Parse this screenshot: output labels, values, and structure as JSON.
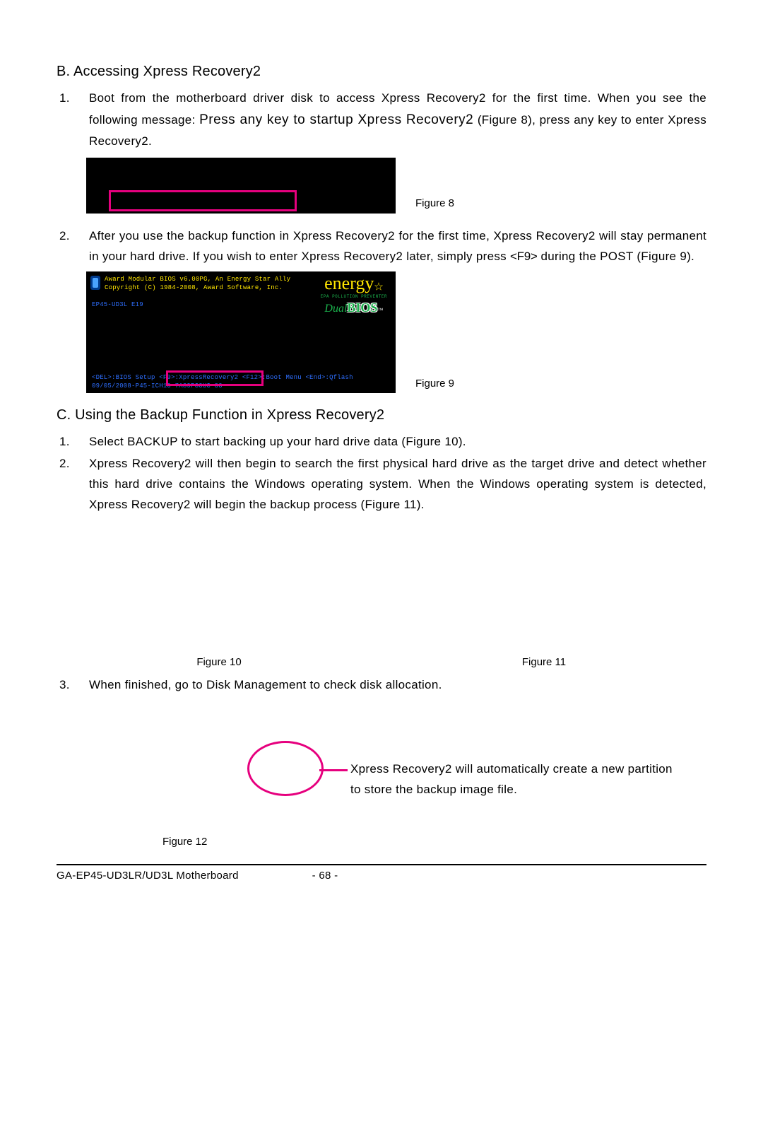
{
  "section_b": {
    "heading": "B. Accessing Xpress Recovery2",
    "item1": {
      "num": "1.",
      "text_a": "Boot from the motherboard driver disk to access Xpress Recovery2 for the first time. When you see the following message: ",
      "emph": "Press any key to startup Xpress Recovery2",
      "text_b": " (Figure 8), press any key to enter Xpress Recovery2."
    },
    "fig8_caption": "Figure 8",
    "item2": {
      "num": "2.",
      "text_a": "After you use the backup function in Xpress Recovery2 for the first time, Xpress Recovery2 will stay permanent in your hard drive. If you wish to enter Xpress Recovery2 later, simply press ",
      "key": "<F9>",
      "text_b": " during the POST (Figure 9)."
    },
    "fig9": {
      "line1": "Award Modular BIOS v6.00PG, An Energy Star Ally",
      "line2": "Copyright (C) 1984-2008, Award Software, Inc.",
      "line3": "EP45-UD3L E19",
      "line4a": "<DEL>:BIOS Setup  <F",
      "line4b": "9>:XpressRecovery2  <F12",
      "line4c": ">:Boot Menu  <End>:Qflash",
      "line5": "09/05/2008-P45-ICH10-7A89PG0UC-00",
      "energy_label": "energy",
      "epa": "EPA  POLLUTION  PREVENTER",
      "dual": "Dual",
      "bios": "BIOS"
    },
    "fig9_caption": "Figure 9"
  },
  "section_c": {
    "heading": "C. Using the Backup Function in Xpress Recovery2",
    "item1": {
      "num": "1.",
      "text_a": "Select ",
      "backup": "BACKUP",
      "text_b": " to start backing up your hard drive data (Figure 10)."
    },
    "item2": {
      "num": "2.",
      "text": "Xpress Recovery2 will then begin to search the first physical hard drive as the target drive and detect whether this hard drive contains the Windows operating system. When the Windows operating system is detected, Xpress Recovery2 will begin the backup process (Figure 11)."
    },
    "fig10_caption": "Figure 10",
    "fig11_caption": "Figure 11",
    "item3": {
      "num": "3.",
      "text_a": "When finished, go to ",
      "dm": "Disk Management",
      "text_b": " to check disk allocation."
    },
    "annotation": "Xpress Recovery2 will automatically create a new partition to store the backup image file.",
    "fig12_caption": "Figure 12"
  },
  "footer": {
    "product": "GA-EP45-UD3LR/UD3L Motherboard",
    "page": "- 68 -"
  }
}
